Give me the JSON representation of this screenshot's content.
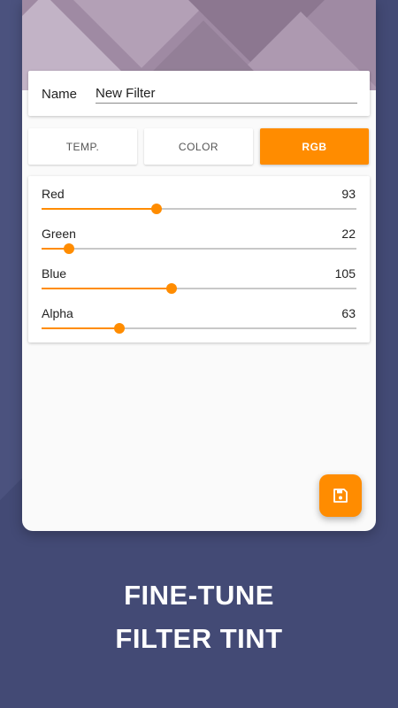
{
  "name_field": {
    "label": "Name",
    "value": "New Filter"
  },
  "tabs": [
    {
      "label": "TEMP.",
      "selected": false
    },
    {
      "label": "COLOR",
      "selected": false
    },
    {
      "label": "RGB",
      "selected": true
    }
  ],
  "sliders": [
    {
      "label": "Red",
      "value": "93",
      "level": 0.365
    },
    {
      "label": "Green",
      "value": "22",
      "level": 0.086
    },
    {
      "label": "Blue",
      "value": "105",
      "level": 0.412
    },
    {
      "label": "Alpha",
      "value": "63",
      "level": 0.247
    }
  ],
  "fab": {
    "icon": "save-icon"
  },
  "headline": {
    "line1": "FINE-TUNE",
    "line2": "FILTER TINT"
  },
  "colors": {
    "accent": "#ff8c00",
    "background": "#434a75"
  }
}
